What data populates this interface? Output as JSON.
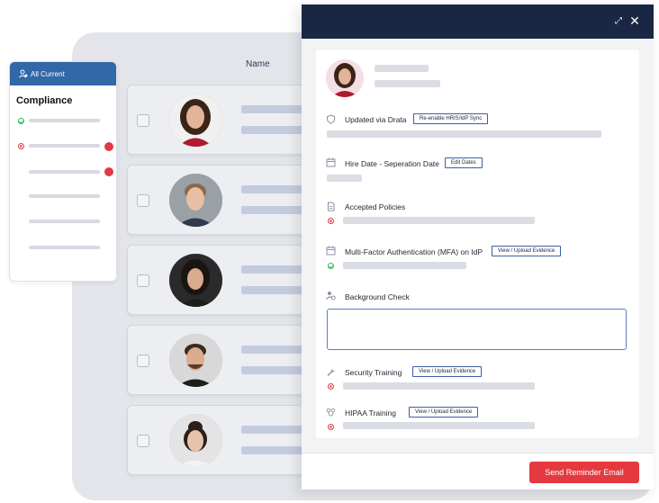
{
  "table": {
    "column_name": "Name"
  },
  "compliance_card": {
    "filter_label": "All Current",
    "title": "Compliance"
  },
  "drawer": {
    "sections": [
      {
        "label": "Updated via Drata",
        "button": "Re-enable HRIS/IdP Sync"
      },
      {
        "label": "Hire Date - Seperation Date",
        "button": "Edit Dates"
      },
      {
        "label": "Accepted Policies"
      },
      {
        "label": "Multi-Factor Authentication (MFA) on IdP",
        "button": "View / Upload Evidence"
      },
      {
        "label": "Background Check"
      },
      {
        "label": "Security Training",
        "button": "View / Upload Evidence"
      },
      {
        "label": "HIPAA Training",
        "button": "View / Upload Evidence"
      }
    ],
    "send_button": "Send Reminder Email"
  },
  "colors": {
    "header_navy": "#1a2744",
    "accent_blue": "#3267a8",
    "danger_red": "#e4393f",
    "success_green": "#34b561"
  }
}
